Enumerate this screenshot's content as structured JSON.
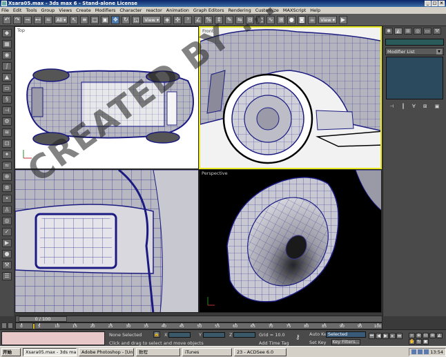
{
  "window": {
    "title": "Xsara05.max - 3ds max 6 - Stand-alone License"
  },
  "menu": [
    "File",
    "Edit",
    "Tools",
    "Group",
    "Views",
    "Create",
    "Modifiers",
    "Character",
    "reactor",
    "Animation",
    "Graph Editors",
    "Rendering",
    "Customize",
    "MAXScript",
    "Help"
  ],
  "toolbar": {
    "selection_filter": "All",
    "ref_coord": "View",
    "right_dropdown": "View"
  },
  "viewports": {
    "top": "Top",
    "front": "Front",
    "perspective": "Perspective"
  },
  "panel": {
    "modifier_list": "Modifier List"
  },
  "timeline": {
    "frame_counter": "0 / 100",
    "ticks": [
      0,
      5,
      10,
      15,
      20,
      25,
      30,
      35,
      40,
      45,
      50,
      55,
      60,
      65,
      70,
      75,
      80,
      85,
      90,
      95,
      100
    ]
  },
  "status": {
    "selection": "None Selected",
    "prompt": "Click and drag to select and move objects",
    "x_label": "X",
    "y_label": "Y",
    "z_label": "Z",
    "grid": "Grid = 10.0",
    "add_time_tag": "Add Time Tag",
    "auto_key": "Auto Key",
    "set_key": "Set Key",
    "key_mode": "Selected",
    "key_filters": "Key Filters..."
  },
  "taskbar": {
    "start": "开始",
    "tasks": [
      "Xsara05.max - 3ds max ...",
      "Adobe Photoshop - [Unti...",
      "数程",
      "iTunes",
      "23 - ACDSee 6.0"
    ],
    "clock": "13:54"
  },
  "watermark": "CREATED BY ..."
}
